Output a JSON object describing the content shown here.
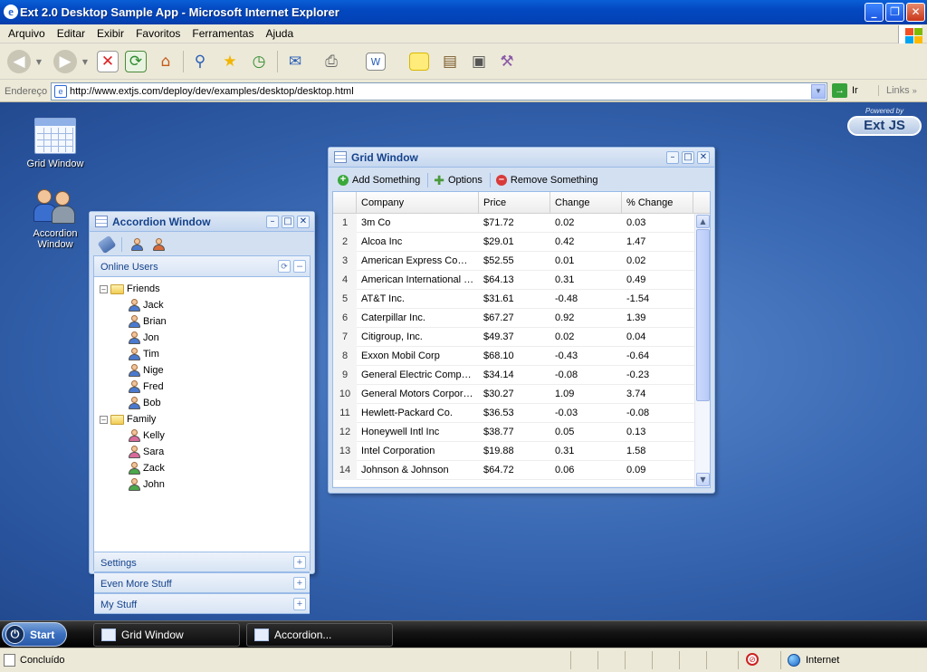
{
  "browser": {
    "title": "Ext 2.0 Desktop Sample App - Microsoft Internet Explorer",
    "menu": [
      "Arquivo",
      "Editar",
      "Exibir",
      "Favoritos",
      "Ferramentas",
      "Ajuda"
    ],
    "address_label": "Endereço",
    "address_value": "http://www.extjs.com/deploy/dev/examples/desktop/desktop.html",
    "go_label": "Ir",
    "links_label": "Links"
  },
  "desktop": {
    "icons": [
      {
        "label": "Grid Window",
        "icon": "grid-window-icon"
      },
      {
        "label": "Accordion Window",
        "icon": "accordion-window-icon"
      }
    ],
    "brand_powered": "Powered by",
    "brand_name": "Ext JS"
  },
  "grid_window": {
    "title": "Grid Window",
    "toolbar": {
      "add": "Add Something",
      "options": "Options",
      "remove": "Remove Something"
    },
    "columns": [
      "Company",
      "Price",
      "Change",
      "% Change"
    ],
    "rows": [
      {
        "n": "1",
        "company": "3m Co",
        "price": "$71.72",
        "change": "0.02",
        "pct": "0.03"
      },
      {
        "n": "2",
        "company": "Alcoa Inc",
        "price": "$29.01",
        "change": "0.42",
        "pct": "1.47"
      },
      {
        "n": "3",
        "company": "American Express Comp...",
        "price": "$52.55",
        "change": "0.01",
        "pct": "0.02"
      },
      {
        "n": "4",
        "company": "American International G...",
        "price": "$64.13",
        "change": "0.31",
        "pct": "0.49"
      },
      {
        "n": "5",
        "company": "AT&T Inc.",
        "price": "$31.61",
        "change": "-0.48",
        "pct": "-1.54"
      },
      {
        "n": "6",
        "company": "Caterpillar Inc.",
        "price": "$67.27",
        "change": "0.92",
        "pct": "1.39"
      },
      {
        "n": "7",
        "company": "Citigroup, Inc.",
        "price": "$49.37",
        "change": "0.02",
        "pct": "0.04"
      },
      {
        "n": "8",
        "company": "Exxon Mobil Corp",
        "price": "$68.10",
        "change": "-0.43",
        "pct": "-0.64"
      },
      {
        "n": "9",
        "company": "General Electric Company",
        "price": "$34.14",
        "change": "-0.08",
        "pct": "-0.23"
      },
      {
        "n": "10",
        "company": "General Motors Corporat...",
        "price": "$30.27",
        "change": "1.09",
        "pct": "3.74"
      },
      {
        "n": "11",
        "company": "Hewlett-Packard Co.",
        "price": "$36.53",
        "change": "-0.03",
        "pct": "-0.08"
      },
      {
        "n": "12",
        "company": "Honeywell Intl Inc",
        "price": "$38.77",
        "change": "0.05",
        "pct": "0.13"
      },
      {
        "n": "13",
        "company": "Intel Corporation",
        "price": "$19.88",
        "change": "0.31",
        "pct": "1.58"
      },
      {
        "n": "14",
        "company": "Johnson & Johnson",
        "price": "$64.72",
        "change": "0.06",
        "pct": "0.09"
      }
    ]
  },
  "accordion_window": {
    "title": "Accordion Window",
    "panels": {
      "online": "Online Users",
      "settings": "Settings",
      "more": "Even More Stuff",
      "mine": "My Stuff"
    },
    "groups": [
      {
        "name": "Friends",
        "members": [
          "Jack",
          "Brian",
          "Jon",
          "Tim",
          "Nige",
          "Fred",
          "Bob"
        ]
      },
      {
        "name": "Family",
        "members": [
          "Kelly",
          "Sara",
          "Zack",
          "John"
        ]
      }
    ]
  },
  "taskbar": {
    "start": "Start",
    "tasks": [
      "Grid Window",
      "Accordion..."
    ]
  },
  "status": {
    "text": "Concluído",
    "zone": "Internet"
  },
  "colors": {
    "header_text": "#15428b",
    "window_border": "#99bbe8"
  }
}
